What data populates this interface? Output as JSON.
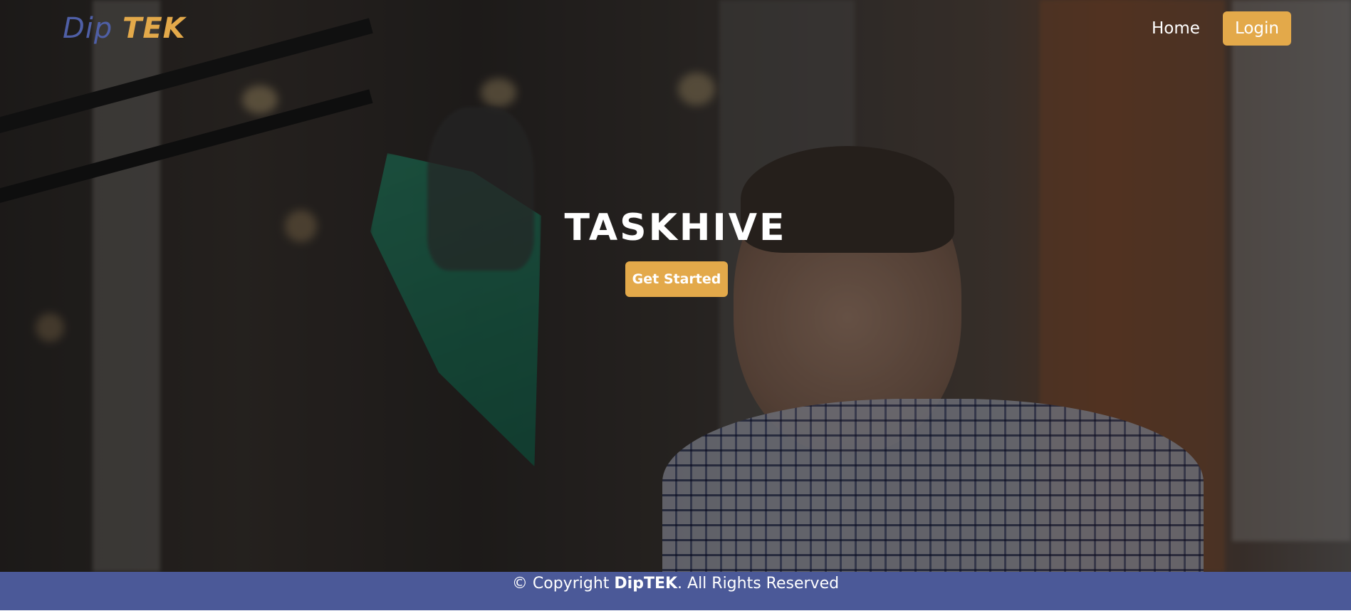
{
  "brand": {
    "part1": "Dip",
    "part2": "TEK"
  },
  "nav": {
    "home_label": "Home",
    "login_label": "Login"
  },
  "hero": {
    "title": "TASKHIVE",
    "cta_label": "Get Started"
  },
  "footer": {
    "copyright_prefix": "© Copyright ",
    "company": "DipTEK",
    "suffix": ". All Rights Reserved"
  },
  "colors": {
    "accent": "#e3a94a",
    "brand_blue": "#4f5fa6",
    "footer_bg": "#4b5998"
  },
  "hero_image": "Blurred office background with a smiling man in a checked shirt and a desk lamp"
}
